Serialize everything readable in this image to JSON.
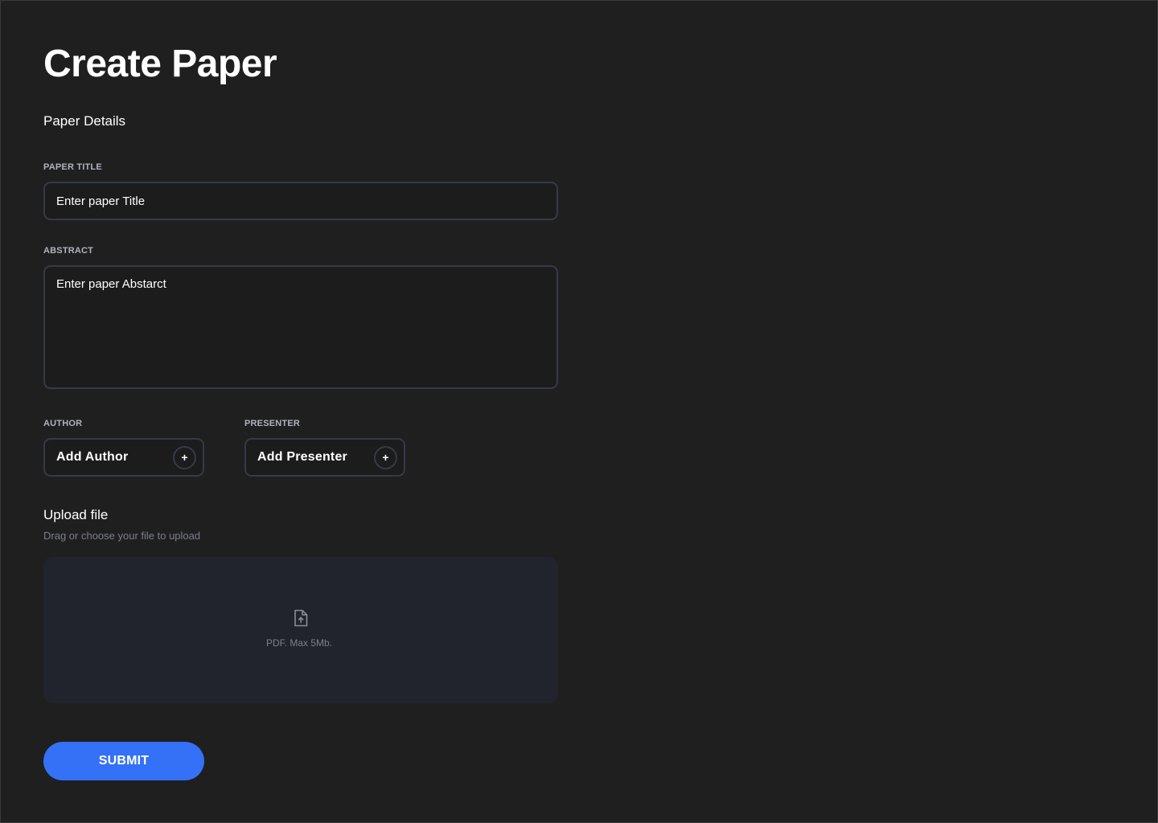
{
  "page": {
    "title": "Create Paper",
    "section_heading": "Paper Details"
  },
  "form": {
    "title_label": "PAPER TITLE",
    "title_placeholder": "Enter paper Title",
    "title_value": "",
    "abstract_label": "ABSTRACT",
    "abstract_placeholder": "Enter paper Abstarct",
    "abstract_value": "",
    "author_label": "AUTHOR",
    "author_button": "Add Author",
    "presenter_label": "PRESENTER",
    "presenter_button": "Add Presenter",
    "plus_glyph": "+"
  },
  "upload": {
    "heading": "Upload file",
    "subtext": "Drag or choose your file to upload",
    "hint": "PDF. Max 5Mb.",
    "icon": "file-upload-icon"
  },
  "actions": {
    "submit_label": "SUBMIT"
  },
  "colors": {
    "background": "#1f1f1f",
    "border": "#363a47",
    "dropzone": "#21242d",
    "accent": "#3571f7",
    "muted_text": "#7c7f89",
    "label_text": "#b0b3bd"
  }
}
